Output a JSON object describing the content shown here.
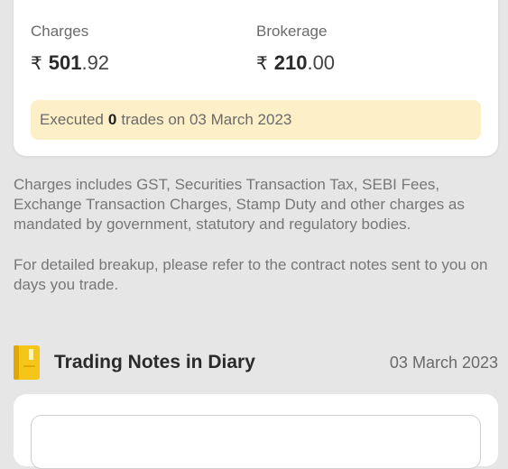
{
  "summary": {
    "charges_label": "Charges",
    "charges_currency": "₹",
    "charges_int": "501",
    "charges_dec": ".92",
    "brokerage_label": "Brokerage",
    "brokerage_currency": "₹",
    "brokerage_int": "210",
    "brokerage_dec": ".00",
    "executed_prefix": "Executed",
    "executed_count": "0",
    "executed_suffix": "trades on 03 March 2023"
  },
  "info": {
    "charges_note": "Charges includes GST, Securities Transaction Tax, SEBI Fees, Exchange Transaction Charges, Stamp Duty and other charges as mandated by government, statutory and regulatory bodies.",
    "breakup_note": "For detailed breakup, please refer to the contract notes sent to you on days you trade."
  },
  "diary": {
    "icon": "notebook-icon",
    "title": "Trading Notes in Diary",
    "date": "03 March 2023"
  },
  "colors": {
    "background": "#e6e6e6",
    "banner": "#fdf0c8",
    "diary_icon": "#f5c518"
  }
}
